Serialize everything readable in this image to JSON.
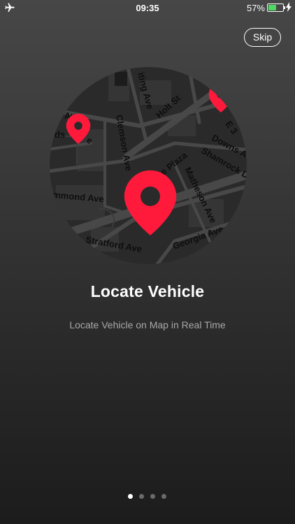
{
  "status_bar": {
    "time": "09:35",
    "battery_percent": "57%",
    "battery_level": 0.57,
    "icons": [
      "airplane-icon",
      "battery-icon",
      "charging-bolt-icon"
    ]
  },
  "skip_label": "Skip",
  "map": {
    "street_labels": [
      "iting Ave",
      "Holt St",
      "Ave",
      "Clemson Ave",
      "E 3",
      "Downs A",
      "Shamrock D",
      "e Plaza",
      "Matheson Ave",
      "mmond Ave",
      "Georgia Ave",
      "Stratford Ave",
      "ods",
      "e"
    ],
    "pin_color": "#ff1a3c",
    "pins": [
      "location-pin-icon",
      "location-pin-icon",
      "location-pin-icon"
    ]
  },
  "title": "Locate Vehicle",
  "subtitle": "Locate Vehicle on Map in Real Time",
  "pagination": {
    "total": 4,
    "active": 0
  }
}
